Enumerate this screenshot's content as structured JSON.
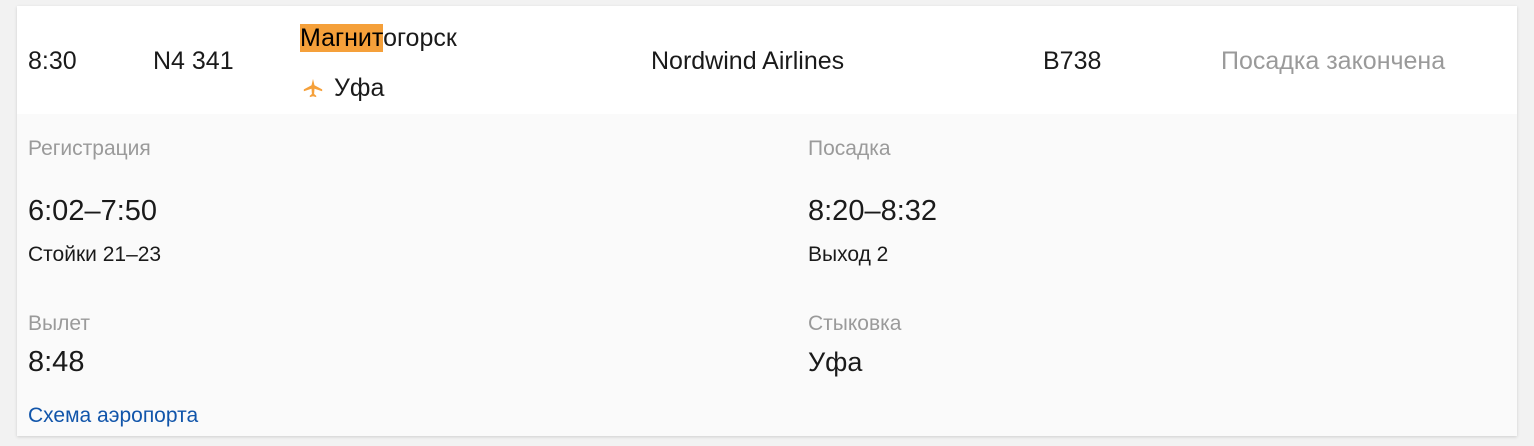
{
  "flight": {
    "time": "8:30",
    "number": "N4 341",
    "destination_highlight": "Магнит",
    "destination_rest": "огорск",
    "via": "Уфа",
    "airline": "Nordwind Airlines",
    "aircraft": "B738",
    "status": "Посадка закончена",
    "icon": "plane-icon"
  },
  "details": {
    "checkin": {
      "label": "Регистрация",
      "time": "6:02–7:50",
      "desks": "Стойки 21–23"
    },
    "boarding": {
      "label": "Посадка",
      "time": "8:20–8:32",
      "gate": "Выход 2"
    },
    "departure": {
      "label": "Вылет",
      "time": "8:48"
    },
    "connection": {
      "label": "Стыковка",
      "city": "Уфа"
    },
    "map_link": "Схема аэропорта"
  },
  "colors": {
    "highlight": "#f5a03a",
    "muted": "#9a9a9a",
    "link": "#1155aa",
    "icon": "#f5a03a"
  }
}
